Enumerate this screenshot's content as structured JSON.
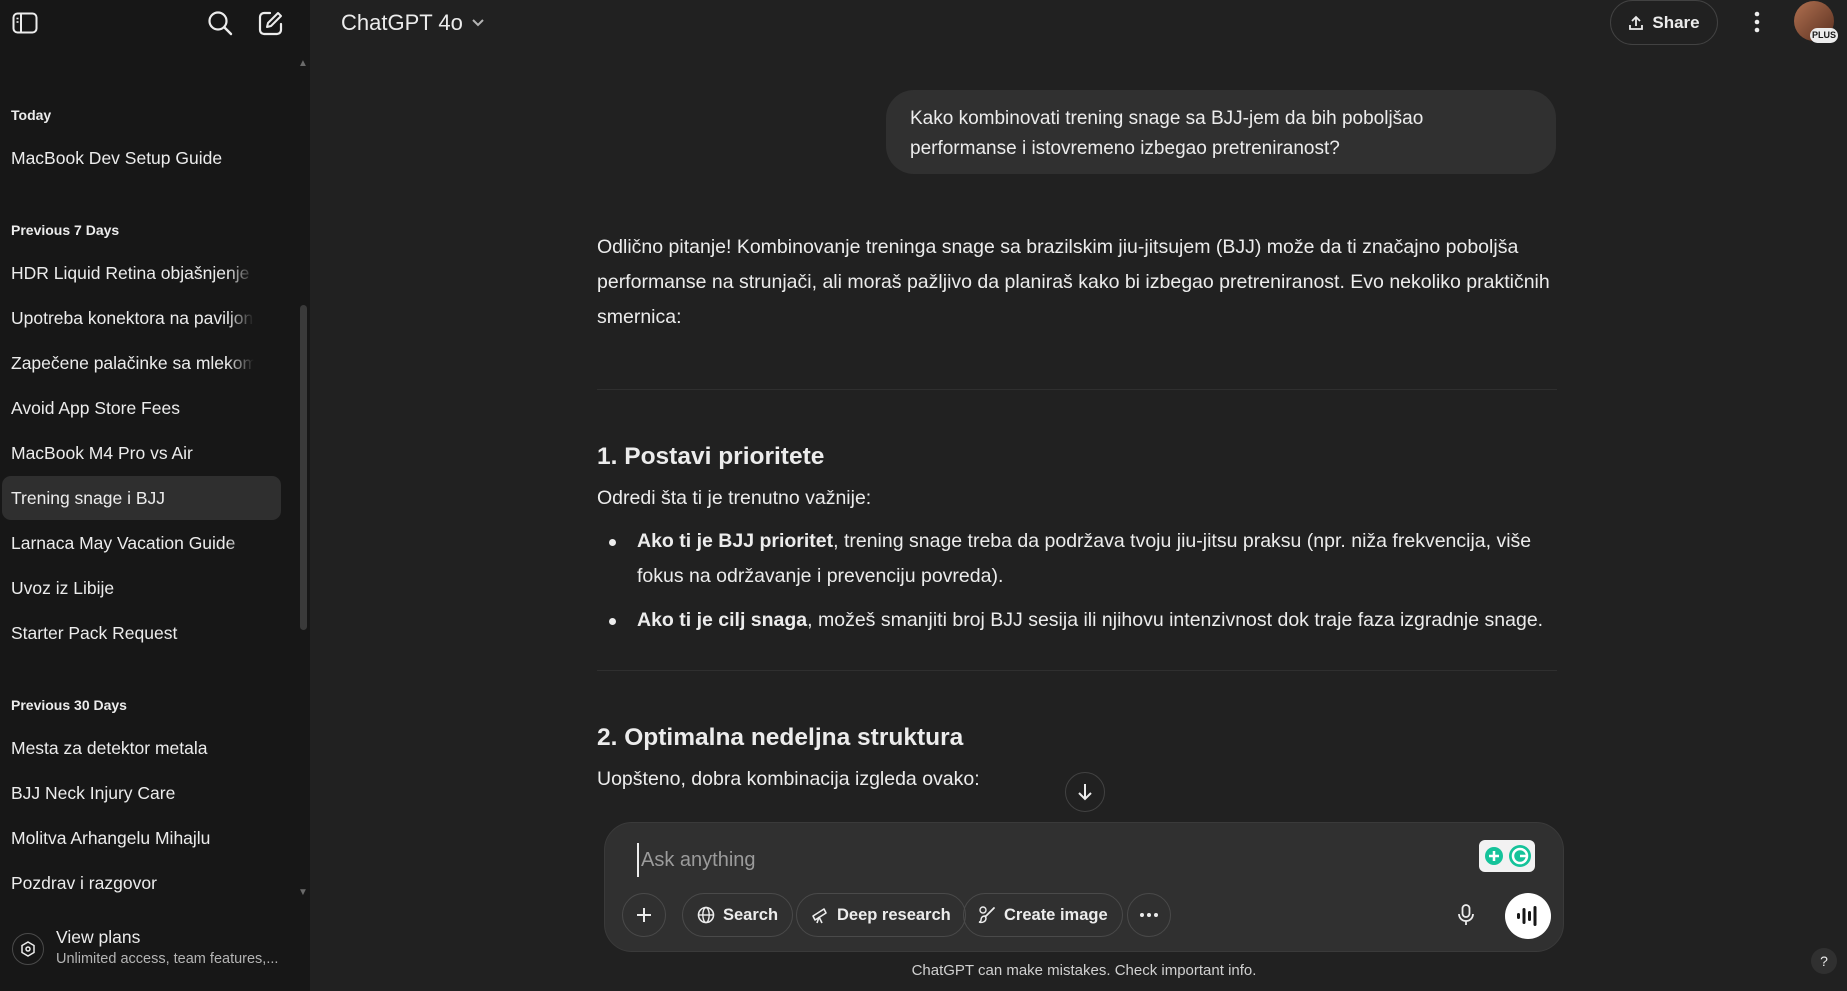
{
  "sidebar": {
    "sections": [
      {
        "title": "Today",
        "items": [
          "MacBook Dev Setup Guide"
        ]
      },
      {
        "title": "Previous 7 Days",
        "items": [
          "HDR Liquid Retina objašnjenje",
          "Upotreba konektora na paviljon",
          "Zapečene palačinke sa mlekom",
          "Avoid App Store Fees",
          "MacBook M4 Pro vs Air",
          "Trening snage i BJJ",
          "Larnaca May Vacation Guide",
          "Uvoz iz Libije",
          "Starter Pack Request"
        ]
      },
      {
        "title": "Previous 30 Days",
        "items": [
          "Mesta za detektor metala",
          "BJJ Neck Injury Care",
          "Molitva Arhangelu Mihajlu",
          "Pozdrav i razgovor"
        ]
      }
    ],
    "active_item": "Trening snage i BJJ",
    "plans": {
      "title": "View plans",
      "subtitle": "Unlimited access, team features,..."
    }
  },
  "header": {
    "model": "ChatGPT 4o",
    "share_label": "Share",
    "plan_badge": "PLUS"
  },
  "conversation": {
    "user_message": "Kako kombinovati trening snage sa BJJ-jem da bih poboljšao performanse i istovremeno izbegao pretreniranost?",
    "intro": "Odlično pitanje! Kombinovanje treninga snage sa brazilskim jiu-jitsujem (BJJ) može da ti značajno poboljša performanse na strunjači, ali moraš pažljivo da planiraš kako bi izbegao pretreniranost. Evo nekoliko praktičnih smernica:",
    "section1": {
      "heading": "1. Postavi prioritete",
      "lead": "Odredi šta ti je trenutno važnije:",
      "bullets": [
        {
          "bold": "Ako ti je BJJ prioritet",
          "rest": ", trening snage treba da podržava tvoju jiu-jitsu praksu (npr. niža frekvencija, više fokus na održavanje i prevenciju povreda)."
        },
        {
          "bold": "Ako ti je cilj snaga",
          "rest": ", možeš smanjiti broj BJJ sesija ili njihovu intenzivnost dok traje faza izgradnje snage."
        }
      ]
    },
    "section2": {
      "heading": "2. Optimalna nedeljna struktura",
      "lead": "Uopšteno, dobra kombinacija izgleda ovako:"
    }
  },
  "composer": {
    "placeholder": "Ask anything",
    "buttons": {
      "search": "Search",
      "deep_research": "Deep research",
      "create_image": "Create image"
    }
  },
  "footer": {
    "disclaimer": "ChatGPT can make mistakes. Check important info.",
    "help": "?"
  }
}
